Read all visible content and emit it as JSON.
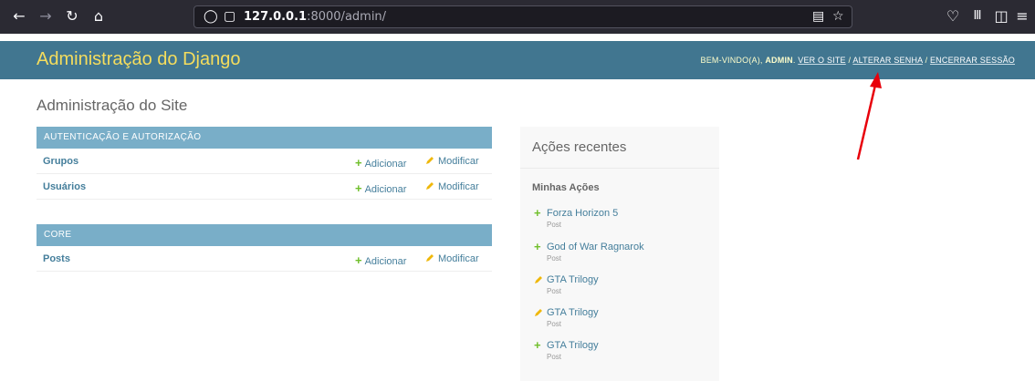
{
  "browser": {
    "url_host": "127.0.0.1",
    "url_rest": ":8000/admin/",
    "icons": [
      "back-icon",
      "forward-icon",
      "reload-icon",
      "home-icon",
      "shield-icon",
      "page-icon",
      "reader-icon",
      "star-icon",
      "pocket-icon",
      "library-icon",
      "sidebar-icon",
      "menu-icon"
    ]
  },
  "header": {
    "branding": "Administração do Django",
    "welcome": "BEM-VINDO(A),",
    "username": "ADMIN",
    "links": [
      "VER O SITE",
      "ALTERAR SENHA",
      "ENCERRAR SESSÃO"
    ],
    "separator": "/"
  },
  "site_title": "Administração do Site",
  "apps": [
    {
      "caption": "Autenticação e Autorização",
      "models": [
        {
          "name": "Grupos",
          "add": "Adicionar",
          "change": "Modificar"
        },
        {
          "name": "Usuários",
          "add": "Adicionar",
          "change": "Modificar"
        }
      ]
    },
    {
      "caption": "Core",
      "models": [
        {
          "name": "Posts",
          "add": "Adicionar",
          "change": "Modificar"
        }
      ]
    }
  ],
  "recent": {
    "title": "Ações recentes",
    "subtitle": "Minhas Ações",
    "actions": [
      {
        "icon": "plus-icon",
        "name": "Forza Horizon 5",
        "type": "Post"
      },
      {
        "icon": "plus-icon",
        "name": "God of War Ragnarok",
        "type": "Post"
      },
      {
        "icon": "pencil-icon",
        "name": "GTA Trilogy",
        "type": "Post"
      },
      {
        "icon": "pencil-icon",
        "name": "GTA Trilogy",
        "type": "Post"
      },
      {
        "icon": "plus-icon",
        "name": "GTA Trilogy",
        "type": "Post"
      }
    ]
  },
  "colors": {
    "header_bg": "#417690",
    "branding": "#f5dd5d",
    "caption_bg": "#79aec8",
    "link": "#447e9b",
    "add_green": "#70bf2b",
    "pencil_yellow": "#efb80b",
    "annotation_arrow": "#e8000b"
  }
}
